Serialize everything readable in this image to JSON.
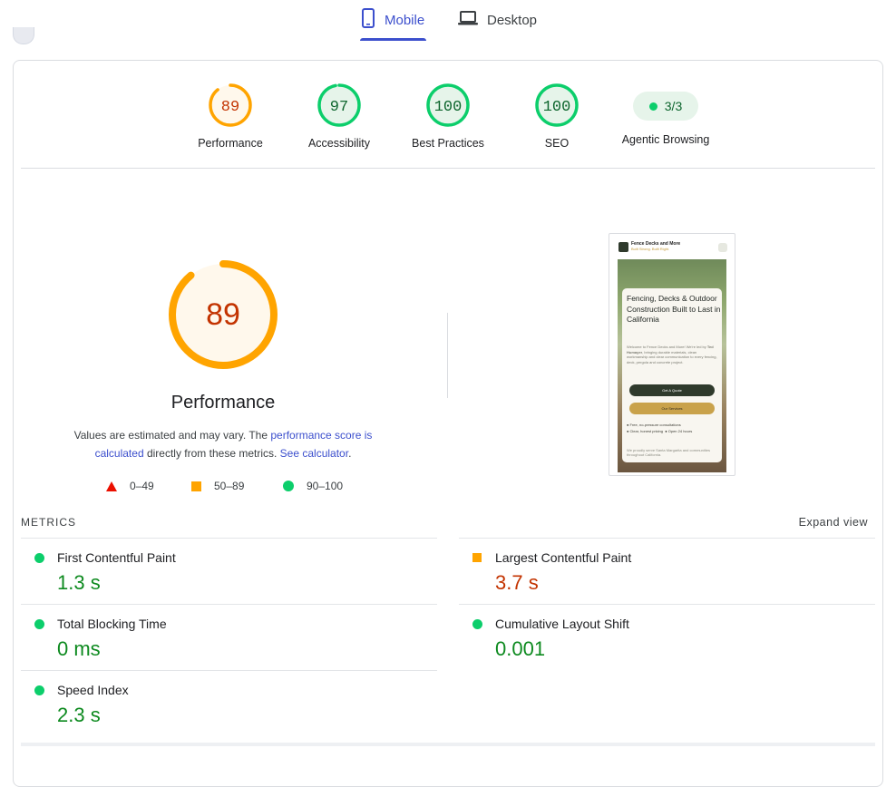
{
  "tabs": [
    {
      "label": "Mobile",
      "active": true,
      "icon": "smartphone-icon"
    },
    {
      "label": "Desktop",
      "active": false,
      "icon": "laptop-icon"
    }
  ],
  "colors": {
    "accent": "#3c4fcd",
    "pass": "#0cce6b",
    "average": "#ffa400",
    "fail": "#eb0f00"
  },
  "categories": [
    {
      "label": "Performance",
      "score": "89",
      "score_fraction": 0.89,
      "status": "average"
    },
    {
      "label": "Accessibility",
      "score": "97",
      "score_fraction": 0.97,
      "status": "pass"
    },
    {
      "label": "Best Practices",
      "score": "100",
      "score_fraction": 1.0,
      "status": "pass"
    },
    {
      "label": "SEO",
      "score": "100",
      "score_fraction": 1.0,
      "status": "pass"
    }
  ],
  "agentic": {
    "label": "Agentic Browsing",
    "value": "3/3"
  },
  "performance": {
    "score": "89",
    "title": "Performance",
    "desc_1": "Values are estimated and may vary. The ",
    "link_score": "performance score is calculated",
    "desc_2": " directly from these metrics. ",
    "link_calc": "See calculator",
    "desc_3": "."
  },
  "legend": [
    {
      "range": "0–49",
      "shape": "triangle"
    },
    {
      "range": "50–89",
      "shape": "square"
    },
    {
      "range": "90–100",
      "shape": "circle"
    }
  ],
  "screenshot": {
    "brand": "Fence Decks and More",
    "tagline": "Built Strong. Built Right.",
    "headline": "Fencing, Decks & Outdoor Construction Built to Last in California",
    "intro_1": "Welcome to Fence Decks and More! We're led by ",
    "intro_name": "Ted Humayer",
    "intro_2": ", bringing durable materials, clean workmanship and clear communication to every fencing, deck, pergola and concrete project.",
    "cta_primary": "Get A Quote",
    "cta_secondary": "Our Services",
    "check_1": "Free, no-pressure consultations",
    "check_2": "Clear, honest pricing",
    "check_3": "Open 24 hours",
    "footer": "We proudly serve Santa Margarita and communities throughout California."
  },
  "metrics": {
    "header": "METRICS",
    "expand": "Expand view",
    "items": [
      {
        "name": "First Contentful Paint",
        "value": "1.3 s",
        "status": "pass"
      },
      {
        "name": "Largest Contentful Paint",
        "value": "3.7 s",
        "status": "average"
      },
      {
        "name": "Total Blocking Time",
        "value": "0 ms",
        "status": "pass"
      },
      {
        "name": "Cumulative Layout Shift",
        "value": "0.001",
        "status": "pass"
      },
      {
        "name": "Speed Index",
        "value": "2.3 s",
        "status": "pass"
      }
    ]
  }
}
